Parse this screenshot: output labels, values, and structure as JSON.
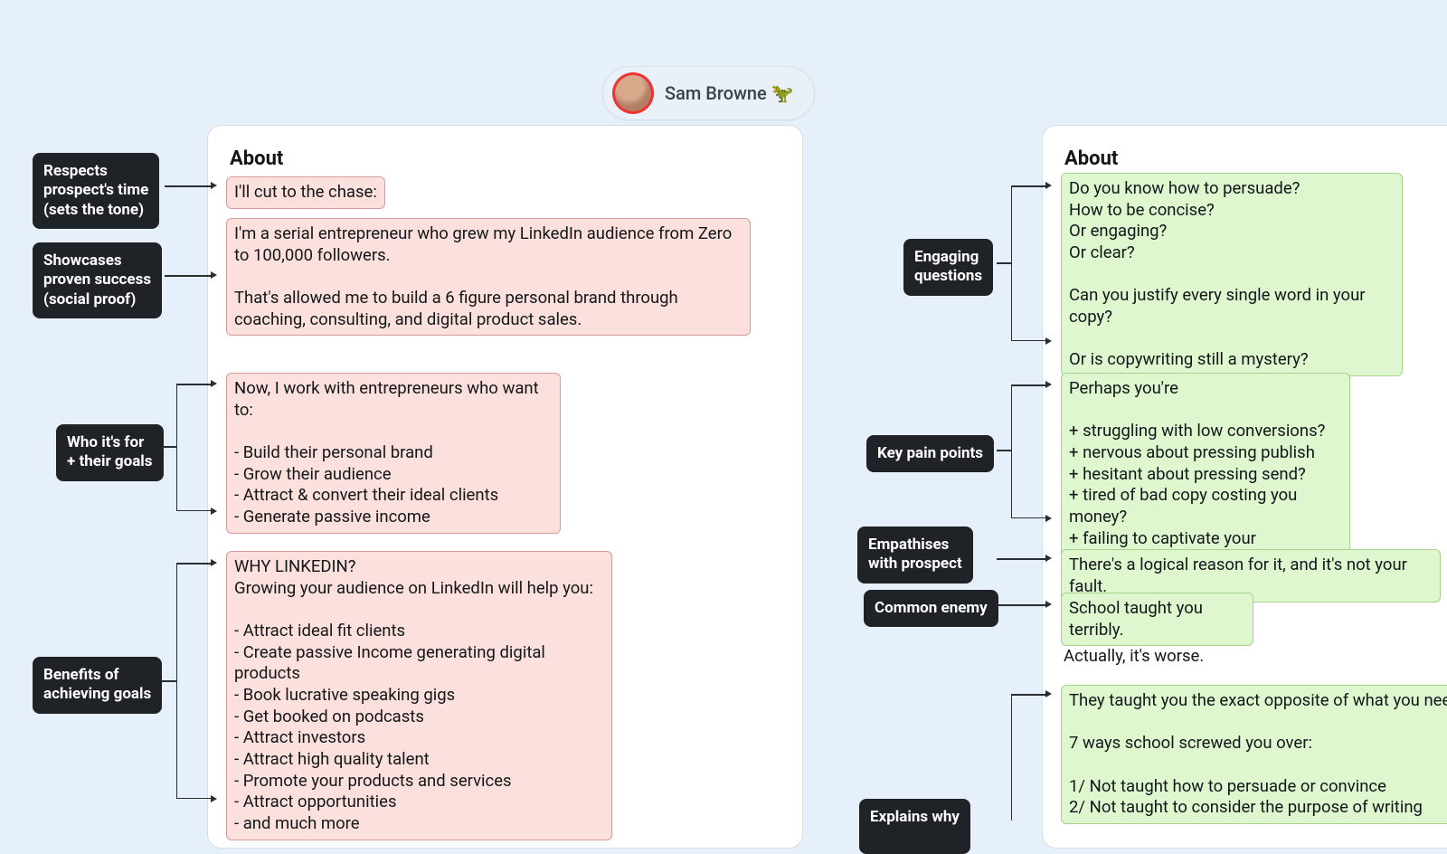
{
  "profile": {
    "name": "Sam Browne 🦖"
  },
  "left": {
    "title": "About",
    "block1": "I'll cut to the chase:",
    "block2": "I'm a serial entrepreneur who grew my LinkedIn audience from Zero to 100,000 followers.\n\nThat's allowed me to build a 6 figure personal brand through coaching, consulting, and digital product sales.",
    "block3": "Now, I work with entrepreneurs who want to:\n\n- Build their personal brand\n- Grow their audience\n- Attract & convert their ideal clients\n- Generate passive income",
    "block4": "WHY LINKEDIN?\nGrowing your audience on LinkedIn will help you:\n\n- Attract ideal fit clients\n- Create passive Income generating digital products\n- Book lucrative speaking gigs\n- Get booked on podcasts\n- Attract investors\n- Attract high quality talent\n- Promote your products and services\n- Attract opportunities\n- and much more",
    "tags": {
      "t1": "Respects\nprospect's time\n(sets the tone)",
      "t2": "Showcases\nproven success\n(social proof)",
      "t3": "Who it's for\n+ their goals",
      "t4": "Benefits of\nachieving goals"
    }
  },
  "right": {
    "title": "About",
    "block1": "Do you know how to persuade?\nHow to be concise?\nOr engaging?\nOr clear?\n\nCan you justify every single word in your copy?\n\nOr is copywriting still a mystery?",
    "block2": "Perhaps you're\n\n+ struggling with low conversions?\n+ nervous about pressing publish\n+ hesitant about pressing send?\n+ tired of bad copy costing you money?\n+ failing to captivate your customers?",
    "block3": "There's a logical reason for it, and it's not your fault.",
    "block4": "School taught you terribly.",
    "plain1": "Actually, it's worse.",
    "block5": "They taught you the exact opposite of what you need\n\n7 ways school screwed you over:\n\n1/ Not taught how to persuade or convince\n2/ Not taught to consider the purpose of writing",
    "tags": {
      "t1": "Engaging\nquestions",
      "t2": "Key pain points",
      "t3": "Empathises\nwith prospect",
      "t4": "Common enemy",
      "t5": "Explains why"
    }
  }
}
